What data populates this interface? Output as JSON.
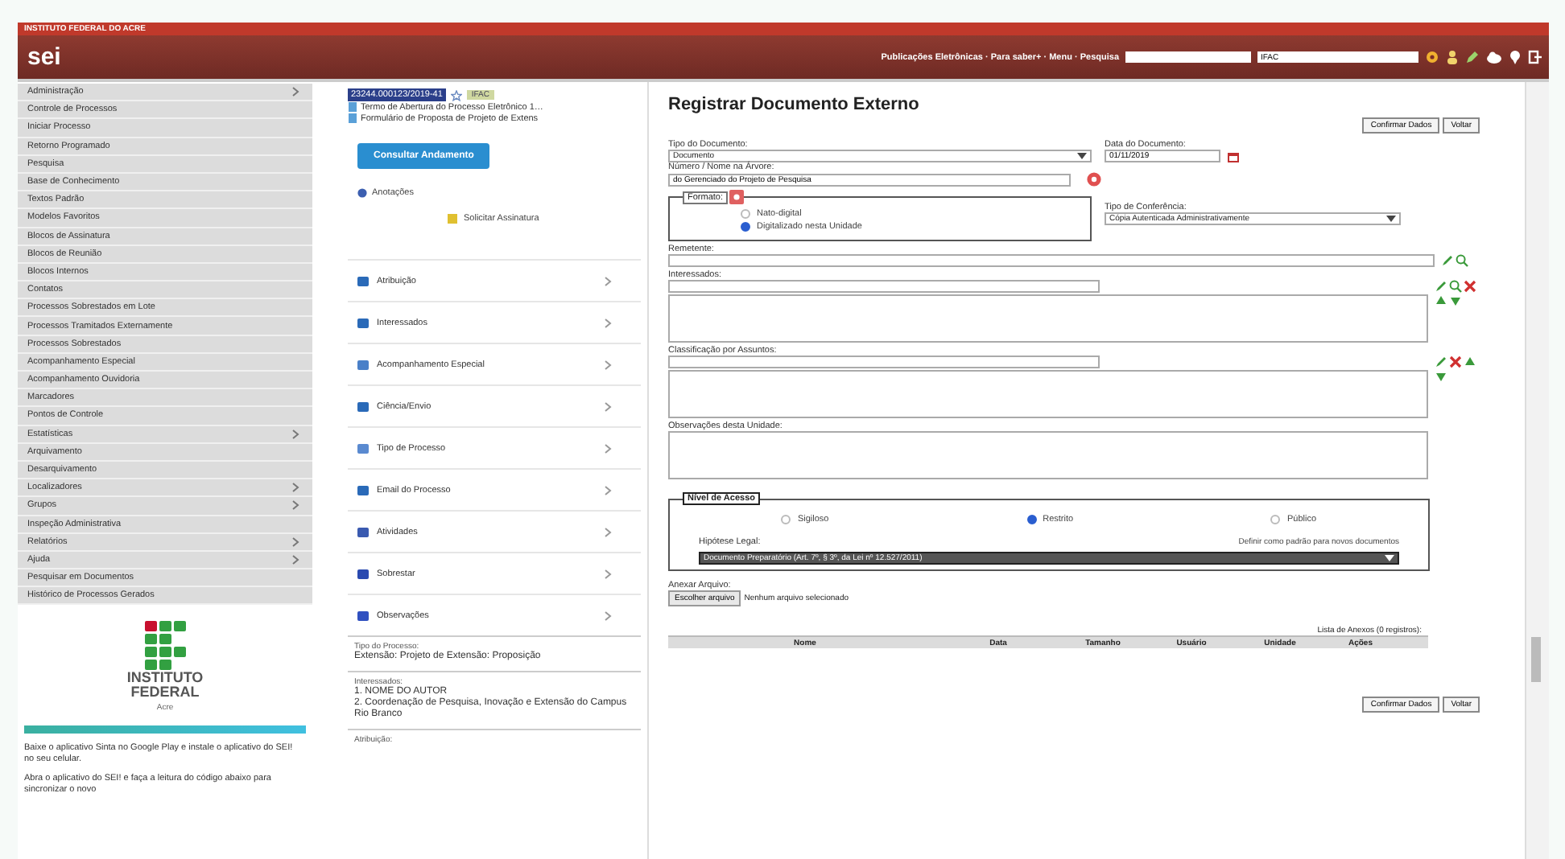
{
  "header": {
    "org": "INSTITUTO FEDERAL DO ACRE",
    "logo": "sei",
    "links": "Publicações Eletrônicas · Para saber+ · Menu · Pesquisa",
    "unit": "IFAC"
  },
  "menu": [
    {
      "label": "Administração",
      "submenu": true
    },
    {
      "label": "Controle de Processos",
      "submenu": false
    },
    {
      "label": "Iniciar Processo",
      "submenu": false
    },
    {
      "label": "Retorno Programado",
      "submenu": false
    },
    {
      "label": "Pesquisa",
      "submenu": false
    },
    {
      "label": "Base de Conhecimento",
      "submenu": false
    },
    {
      "label": "Textos Padrão",
      "submenu": false
    },
    {
      "label": "Modelos Favoritos",
      "submenu": false
    },
    {
      "label": "Blocos de Assinatura",
      "submenu": false
    },
    {
      "label": "Blocos de Reunião",
      "submenu": false
    },
    {
      "label": "Blocos Internos",
      "submenu": false
    },
    {
      "label": "Contatos",
      "submenu": false
    },
    {
      "label": "Processos Sobrestados em Lote",
      "submenu": false
    },
    {
      "label": "Processos Tramitados Externamente",
      "submenu": false
    },
    {
      "label": "Processos Sobrestados",
      "submenu": false
    },
    {
      "label": "Acompanhamento Especial",
      "submenu": false
    },
    {
      "label": "Acompanhamento Ouvidoria",
      "submenu": false
    },
    {
      "label": "Marcadores",
      "submenu": false
    },
    {
      "label": "Pontos de Controle",
      "submenu": false
    },
    {
      "label": "Estatísticas",
      "submenu": true
    },
    {
      "label": "Arquivamento",
      "submenu": false
    },
    {
      "label": "Desarquivamento",
      "submenu": false
    },
    {
      "label": "Localizadores",
      "submenu": true
    },
    {
      "label": "Grupos",
      "submenu": true
    },
    {
      "label": "Inspeção Administrativa",
      "submenu": false
    },
    {
      "label": "Relatórios",
      "submenu": true
    },
    {
      "label": "Ajuda",
      "submenu": true
    },
    {
      "label": "Pesquisar em Documentos",
      "submenu": false
    },
    {
      "label": "Histórico de Processos Gerados",
      "submenu": false
    }
  ],
  "brand": {
    "line1": "INSTITUTO",
    "line2": "FEDERAL",
    "line3": "Acre"
  },
  "app_notes": [
    "Baixe o aplicativo Sinta no Google Play e instale o aplicativo do SEI! no seu celular.",
    "Abra o aplicativo do SEI! e faça a leitura do código abaixo para sincronizar o novo"
  ],
  "process": {
    "number": "23244.000123/2019-41",
    "badge": "IFAC",
    "docs": [
      "Termo de Abertura do Processo Eletrônico 1…",
      "Formulário de Proposta de Projeto de Extens"
    ],
    "button": "Consultar Andamento",
    "note_title": "Anotações",
    "note": "Solicitar Assinatura",
    "sections": [
      "Atribuição",
      "Interessados",
      "Acompanhamento Especial",
      "Ciência/Envio",
      "Tipo de Processo",
      "Email do Processo",
      "Atividades",
      "Sobrestar",
      "Observações"
    ],
    "info": [
      {
        "title": "Tipo do Processo:",
        "lines": [
          "Extensão: Projeto de Extensão: Proposição"
        ]
      },
      {
        "title": "Interessados:",
        "lines": [
          "1. NOME DO AUTOR",
          "2. Coordenação de Pesquisa, Inovação e Extensão do Campus Rio Branco"
        ]
      },
      {
        "title": "Atribuição:"
      }
    ]
  },
  "form": {
    "title": "Registrar Documento Externo",
    "buttons": [
      "Confirmar Dados",
      "Voltar"
    ],
    "doc_type": {
      "label": "Tipo do Documento:",
      "value": "Documento"
    },
    "doc_date": {
      "label": "Data do Documento:",
      "value": "01/11/2019"
    },
    "tree_name": {
      "label": "Número / Nome na Árvore:",
      "value": "do Gerenciado do Projeto de Pesquisa"
    },
    "format": {
      "legend": "Formato:",
      "options": [
        {
          "label": "Nato-digital",
          "selected": false
        },
        {
          "label": "Digitalizado nesta Unidade",
          "selected": true
        }
      ]
    },
    "conference": {
      "label": "Tipo de Conferência:",
      "value": "Cópia Autenticada Administrativamente"
    },
    "sender": "Remetente:",
    "interested": "Interessados:",
    "classification": "Classificação por Assuntos:",
    "notes": "Observações desta Unidade:",
    "access": {
      "legend": "Nível de Acesso",
      "options": [
        {
          "label": "Sigiloso",
          "selected": false
        },
        {
          "label": "Restrito",
          "selected": true
        },
        {
          "label": "Público",
          "selected": false
        }
      ],
      "legal_label": "Hipótese Legal:",
      "legal_hint": "Definir como padrão para novos documentos",
      "legal_value": "Documento Preparatório (Art. 7º, § 3º, da Lei nº 12.527/2011)"
    },
    "attach": {
      "label": "Anexar Arquivo:",
      "button": "Escolher arquivo",
      "status": "Nenhum arquivo selecionado"
    },
    "attachments": {
      "caption": "Lista de Anexos (0 registros):",
      "columns": [
        "Nome",
        "Data",
        "Tamanho",
        "Usuário",
        "Unidade",
        "Ações"
      ]
    },
    "bottom_buttons": [
      "Confirmar Dados",
      "Voltar"
    ]
  }
}
